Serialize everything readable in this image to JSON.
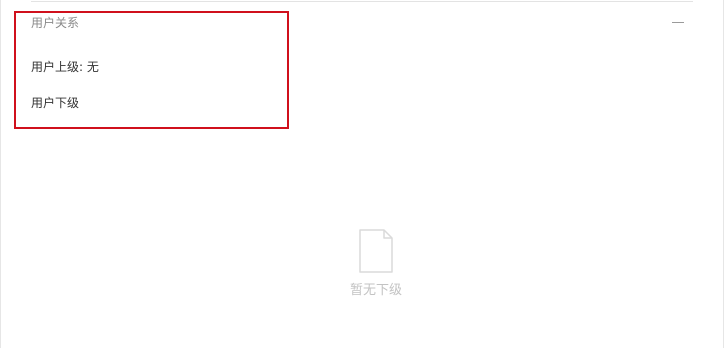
{
  "section": {
    "title": "用户关系",
    "collapse_icon": "minus-icon"
  },
  "relations": {
    "parent_label": "用户上级:",
    "parent_value": "无",
    "children_label": "用户下级"
  },
  "empty_state": {
    "icon": "empty-document-icon",
    "text": "暂无下级"
  },
  "colors": {
    "highlight": "#d0101c",
    "muted_text": "#8a8a8a",
    "primary_text": "#333333",
    "empty_text": "#c3c3c3"
  }
}
